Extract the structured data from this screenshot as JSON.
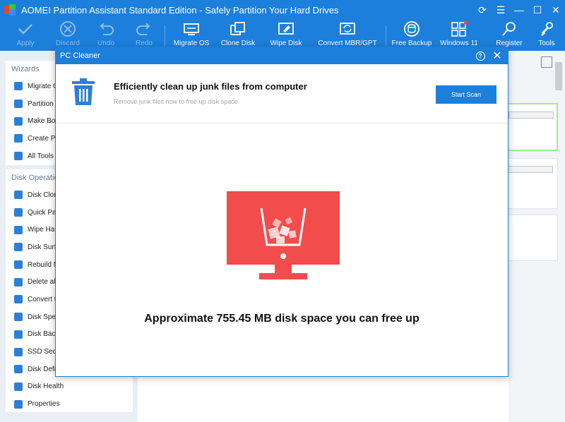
{
  "window": {
    "title": "AOMEI Partition Assistant Standard Edition - Safely Partition Your Hard Drives"
  },
  "toolbar": {
    "apply": "Apply",
    "discard": "Discard",
    "undo": "Undo",
    "redo": "Redo",
    "migrate_os": "Migrate OS",
    "clone_disk": "Clone Disk",
    "wipe_disk": "Wipe Disk",
    "convert_mbr_gpt": "Convert MBR/GPT",
    "free_backup": "Free Backup",
    "windows11": "Windows 11",
    "register": "Register",
    "tools": "Tools"
  },
  "sidebar": {
    "wizards_title": "Wizards",
    "wizards": [
      {
        "label": "Migrate OS to SSD",
        "icon": "migrate-icon"
      },
      {
        "label": "Partition Recovery Wizard",
        "icon": "recovery-icon"
      },
      {
        "label": "Make Bootable Media",
        "icon": "boot-media-icon"
      },
      {
        "label": "Create Portable Version",
        "icon": "portable-icon"
      },
      {
        "label": "All Tools",
        "icon": "more-icon"
      }
    ],
    "disk_ops_title": "Disk Operations",
    "disk_ops": [
      {
        "label": "Disk Clone",
        "icon": "clone-icon"
      },
      {
        "label": "Quick Partition",
        "icon": "quick-partition-icon"
      },
      {
        "label": "Wipe Hard Drive",
        "icon": "wipe-icon"
      },
      {
        "label": "Disk Surface Test",
        "icon": "surface-test-icon"
      },
      {
        "label": "Rebuild MBR",
        "icon": "rebuild-icon"
      },
      {
        "label": "Delete all Partitions",
        "icon": "delete-icon"
      },
      {
        "label": "Convert to GPT",
        "icon": "convert-icon"
      },
      {
        "label": "Disk Speed Test",
        "icon": "speed-icon"
      },
      {
        "label": "Disk Backup",
        "icon": "backup-icon"
      },
      {
        "label": "SSD Secure Erase",
        "icon": "erase-icon"
      },
      {
        "label": "Disk Defrag",
        "icon": "defrag-icon"
      },
      {
        "label": "Disk Health",
        "icon": "health-icon"
      },
      {
        "label": "Properties",
        "icon": "info-icon"
      }
    ]
  },
  "dialog": {
    "title": "PC Cleaner",
    "heading": "Efficiently clean up junk files from computer",
    "subheading": "Remove junk files now to free up disk space.",
    "start_button": "Start Scan",
    "result_text": "Approximate 755.45 MB disk space you can free up"
  },
  "colors": {
    "accent": "#1c7fdc",
    "monitor": "#f24c4c"
  }
}
